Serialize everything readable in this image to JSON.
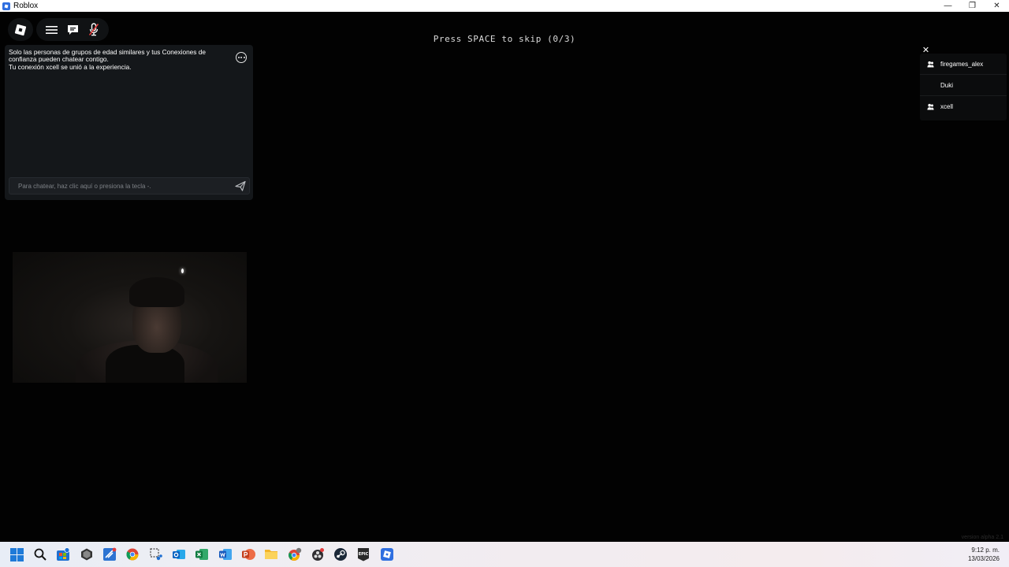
{
  "window": {
    "title": "Roblox",
    "minimize": "—",
    "restore": "❐",
    "close": "✕"
  },
  "game": {
    "skip_prompt": "Press SPACE to skip (0/3)",
    "version": "version alpha 2.1"
  },
  "chat": {
    "messages": [
      "Solo las personas de grupos de edad similares y tus Conexiones de confianza pueden chatear contigo.",
      "Tu conexión xcell se unió a la experiencia."
    ],
    "input_placeholder": "Para chatear, haz clic aquí o presiona la tecla -."
  },
  "players": {
    "close": "✕",
    "list": [
      {
        "name": "firegames_alex",
        "icon": "friends-icon"
      },
      {
        "name": "Duki",
        "icon": ""
      },
      {
        "name": "xcell",
        "icon": "friends-icon"
      }
    ]
  },
  "taskbar": {
    "icons": [
      "windows-start",
      "search",
      "microsoft-store",
      "unity",
      "visual-studio",
      "chrome",
      "snipping-tool",
      "outlook",
      "excel",
      "word",
      "powerpoint",
      "file-explorer",
      "chrome-profile",
      "obs",
      "steam",
      "epic-games",
      "roblox"
    ],
    "time": "9:12 p. m.",
    "date": "13/03/2026"
  },
  "colors": {
    "background": "#000000",
    "chat_panel": "#14171a",
    "taskbar_start": "#e8edf6",
    "roblox_blue": "#2f6fe0"
  }
}
